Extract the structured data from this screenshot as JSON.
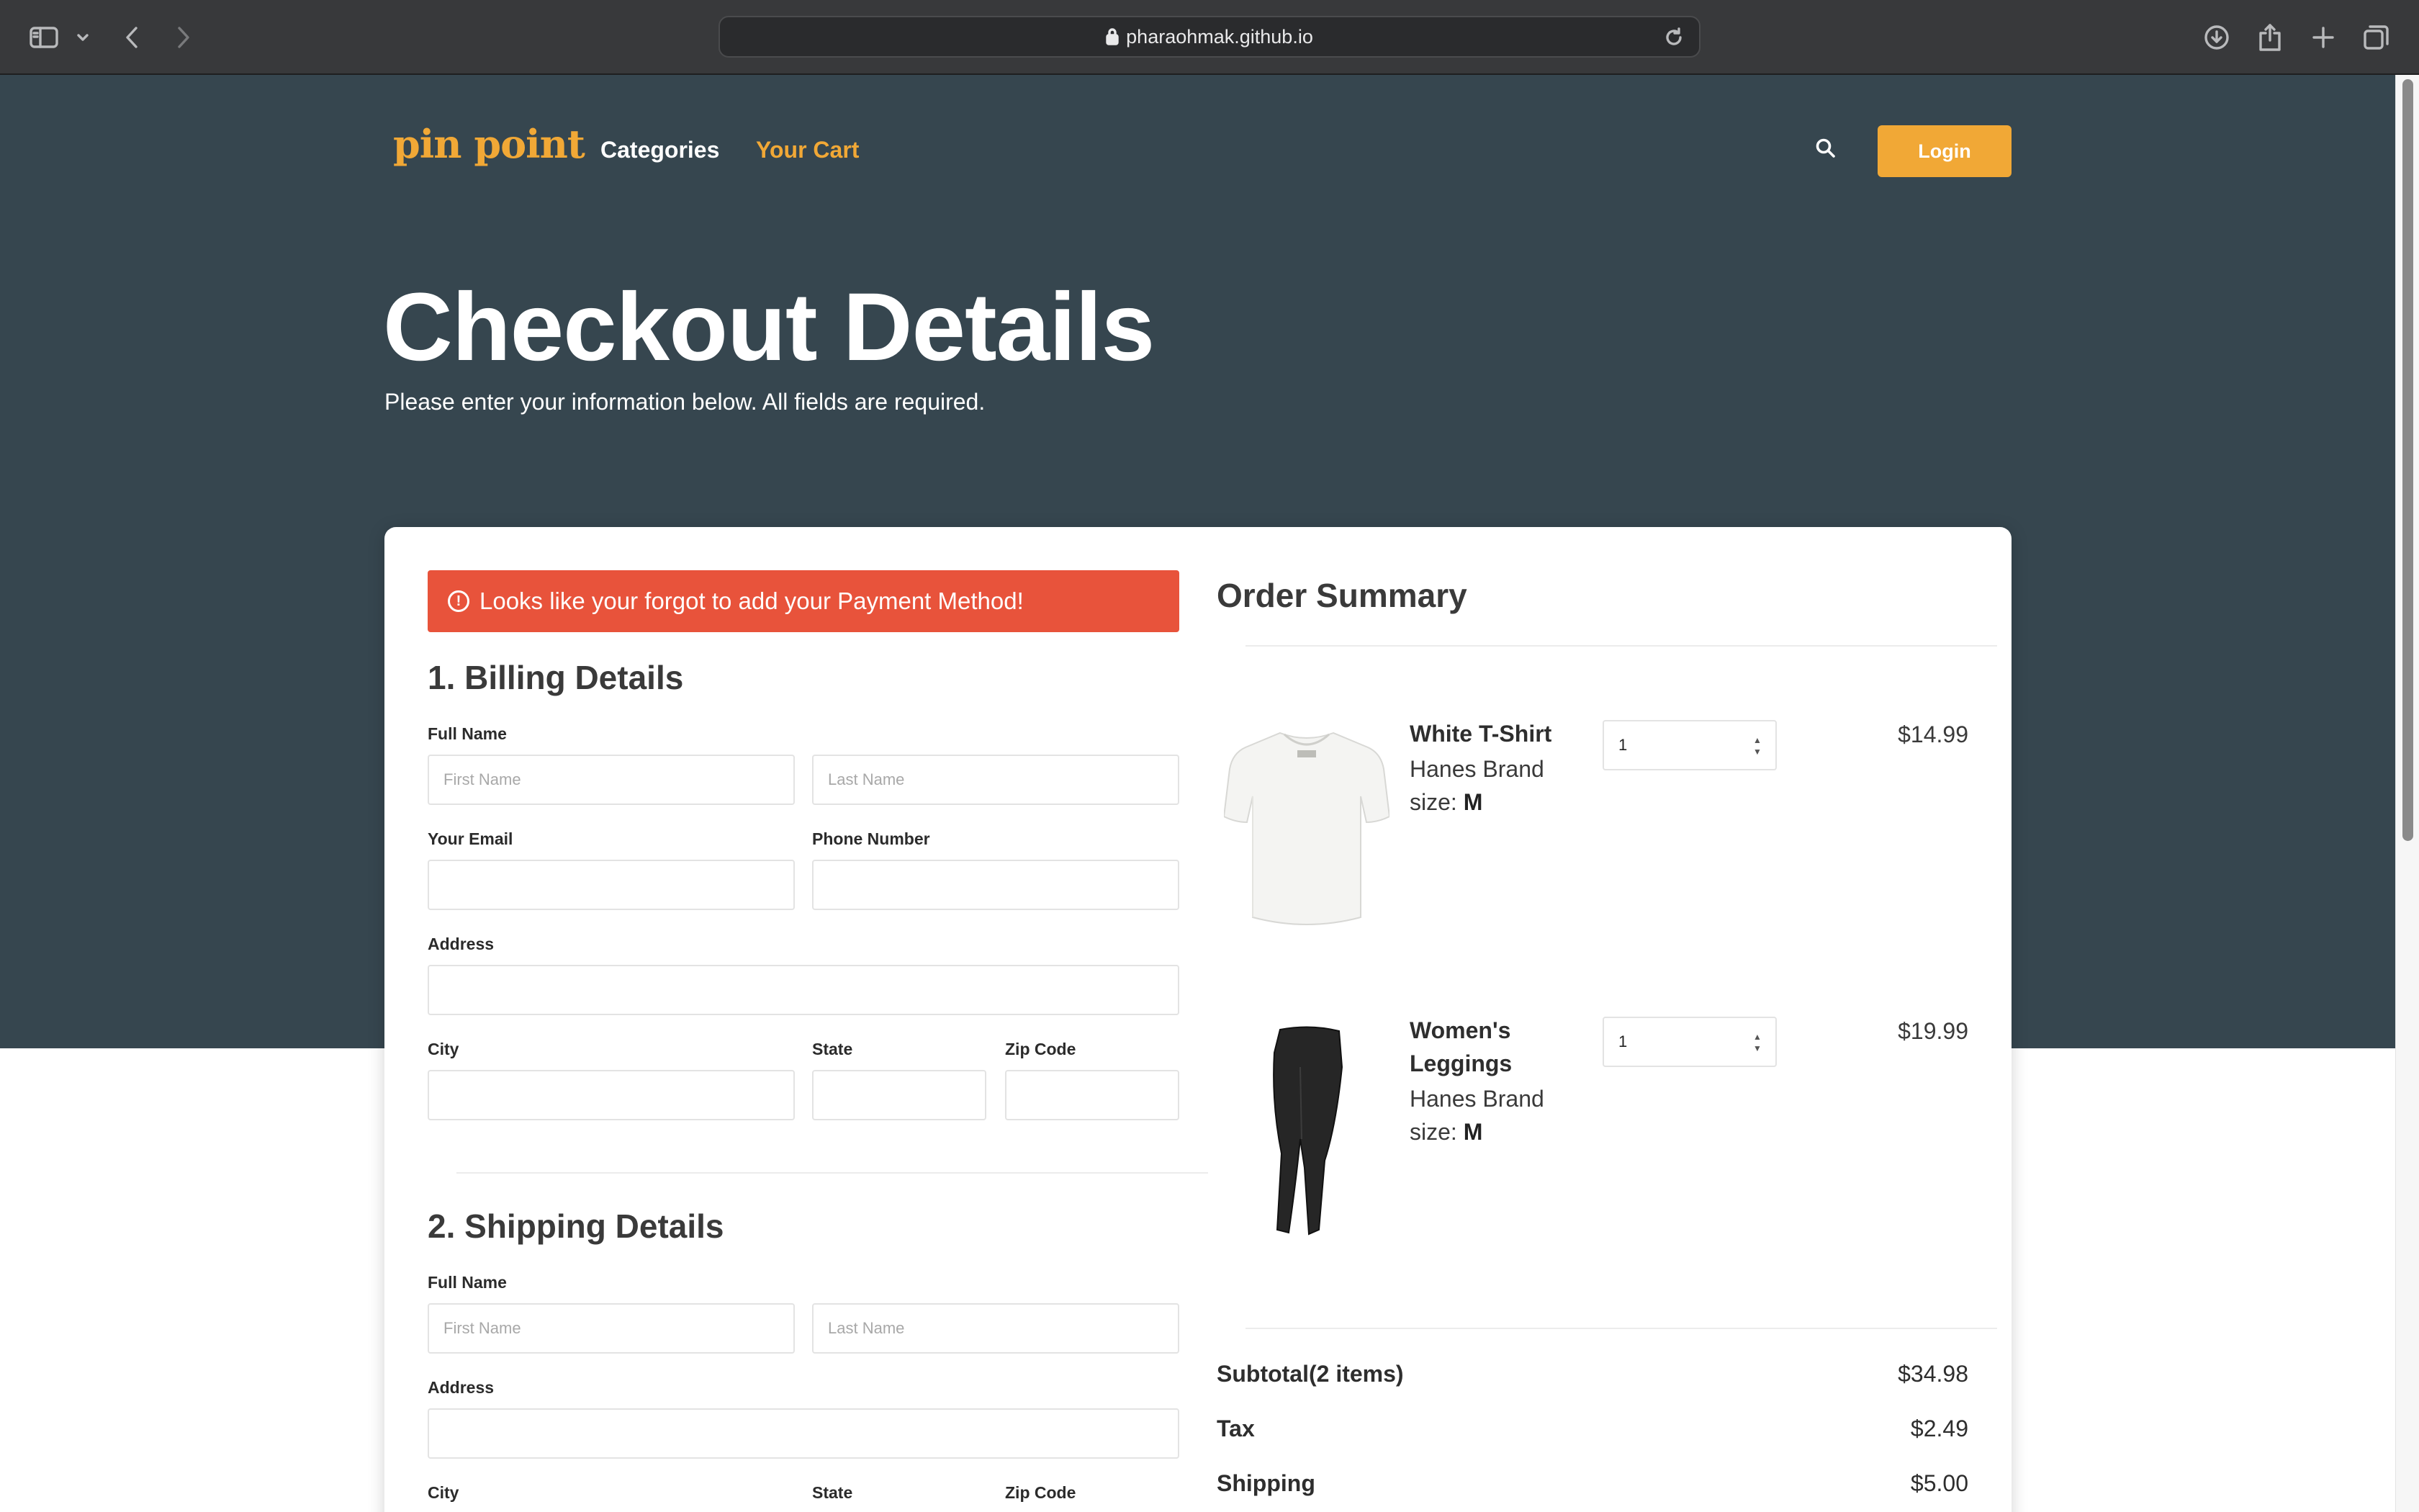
{
  "browser": {
    "url": "pharaohmak.github.io"
  },
  "nav": {
    "logo": "pin point",
    "categories": "Categories",
    "cart": "Your Cart",
    "login": "Login"
  },
  "header": {
    "title": "Checkout Details",
    "subtitle": "Please enter your information below. All fields are required."
  },
  "alert": {
    "message": "Looks like your forgot to add your Payment Method!"
  },
  "billing": {
    "title": "1. Billing Details",
    "full_name_label": "Full Name",
    "first_name_placeholder": "First Name",
    "last_name_placeholder": "Last Name",
    "email_label": "Your Email",
    "phone_label": "Phone Number",
    "address_label": "Address",
    "city_label": "City",
    "state_label": "State",
    "zip_label": "Zip Code"
  },
  "shipping": {
    "title": "2. Shipping Details",
    "full_name_label": "Full Name",
    "first_name_placeholder": "First Name",
    "last_name_placeholder": "Last Name",
    "address_label": "Address",
    "city_label": "City",
    "state_label": "State",
    "zip_label": "Zip Code"
  },
  "summary": {
    "title": "Order Summary",
    "items": [
      {
        "name": "White T-Shirt",
        "name_line2": "",
        "brand": "Hanes Brand",
        "size_label": "size:",
        "size": "M",
        "qty": "1",
        "price": "$14.99"
      },
      {
        "name": "Women's",
        "name_line2": "Leggings",
        "brand": "Hanes Brand",
        "size_label": "size:",
        "size": "M",
        "qty": "1",
        "price": "$19.99"
      }
    ],
    "subtotal_label": "Subtotal(2 items)",
    "subtotal": "$34.98",
    "tax_label": "Tax",
    "tax": "$2.49",
    "shipping_label": "Shipping",
    "shipping": "$5.00"
  },
  "colors": {
    "hero_bg": "#36464f",
    "accent": "#f1a836",
    "alert": "#e8533b"
  }
}
